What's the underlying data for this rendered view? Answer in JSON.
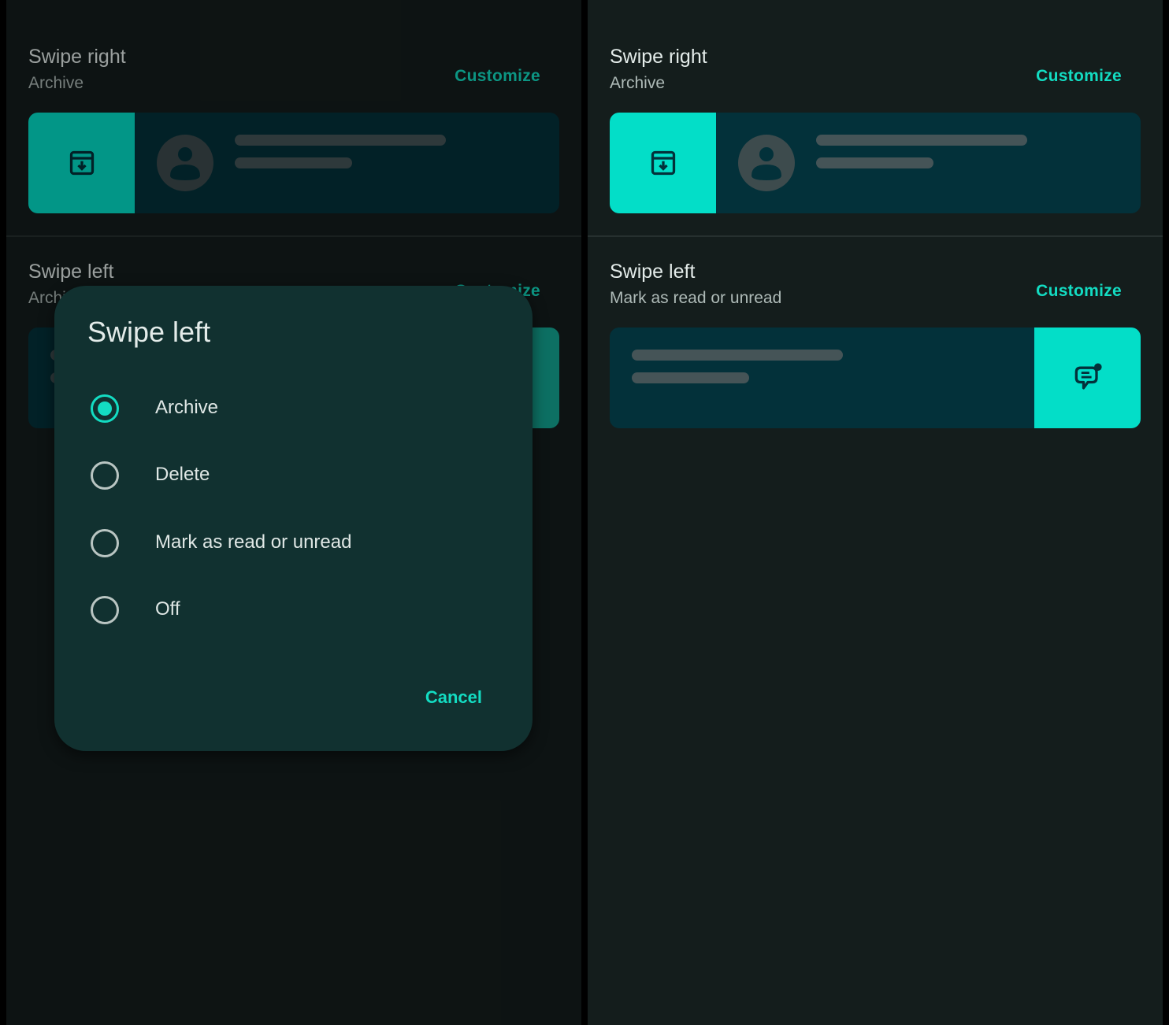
{
  "left": {
    "swipe_right": {
      "title": "Swipe right",
      "value": "Archive",
      "customize": "Customize"
    },
    "swipe_left": {
      "title": "Swipe left",
      "value": "Archive",
      "customize": "Customize"
    },
    "dialog": {
      "title": "Swipe left",
      "options": [
        {
          "label": "Archive",
          "selected": true
        },
        {
          "label": "Delete",
          "selected": false
        },
        {
          "label": "Mark as read or unread",
          "selected": false
        },
        {
          "label": "Off",
          "selected": false
        }
      ],
      "cancel": "Cancel"
    }
  },
  "right": {
    "swipe_right": {
      "title": "Swipe right",
      "value": "Archive",
      "customize": "Customize"
    },
    "swipe_left": {
      "title": "Swipe left",
      "value": "Mark as read or unread",
      "customize": "Customize"
    }
  },
  "icons": {
    "swipe_right_action": "archive-icon",
    "swipe_left_action": "mark-read-unread-icon",
    "avatar": "person-icon"
  },
  "colors": {
    "accent": "#13dcc2",
    "action_background": "#03dec8",
    "card_background": "#03313a",
    "page_background": "#141d1c",
    "dialog_background": "#113130"
  }
}
